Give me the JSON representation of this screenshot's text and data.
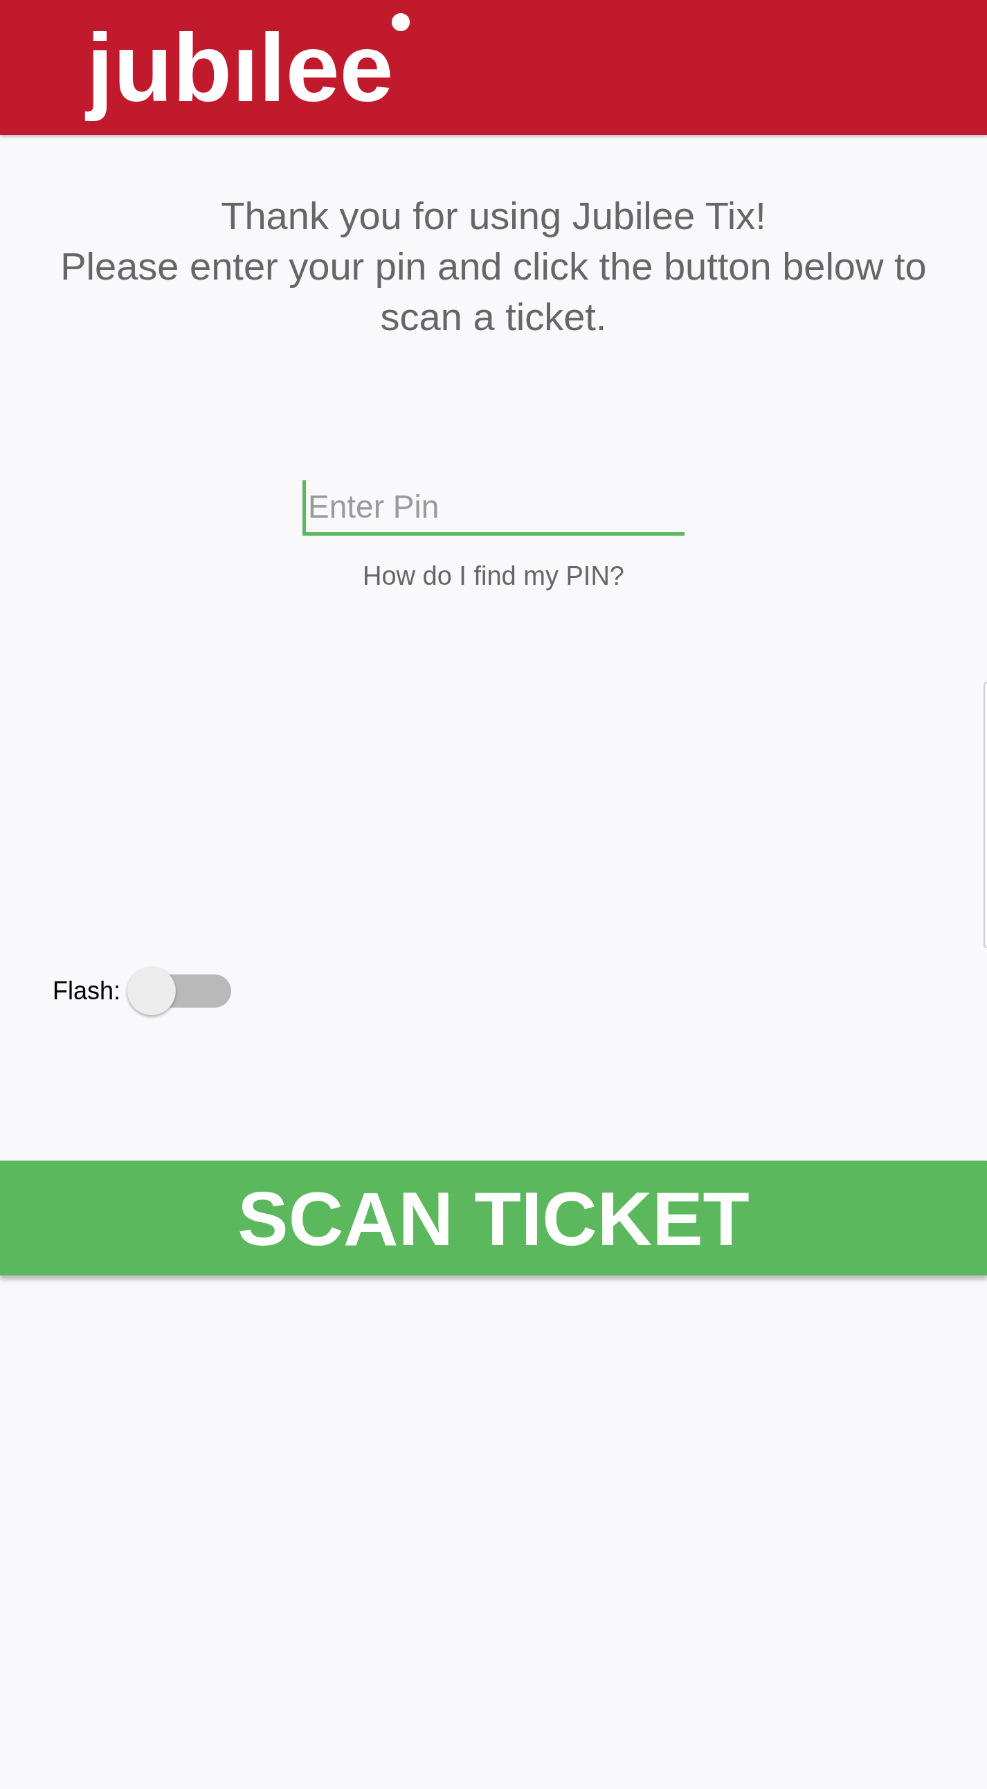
{
  "header": {
    "logo": "jubılee"
  },
  "message": [
    "Thank you for using Jubilee Tix!",
    "Please enter your pin and click the button below to scan a ticket."
  ],
  "pin_field": {
    "placeholder": "Enter Pin",
    "focused": true
  },
  "help_link": "How do I find my PIN?",
  "flash": {
    "label": "Flash:",
    "on": false
  },
  "scan_button": "SCAN TICKET"
}
